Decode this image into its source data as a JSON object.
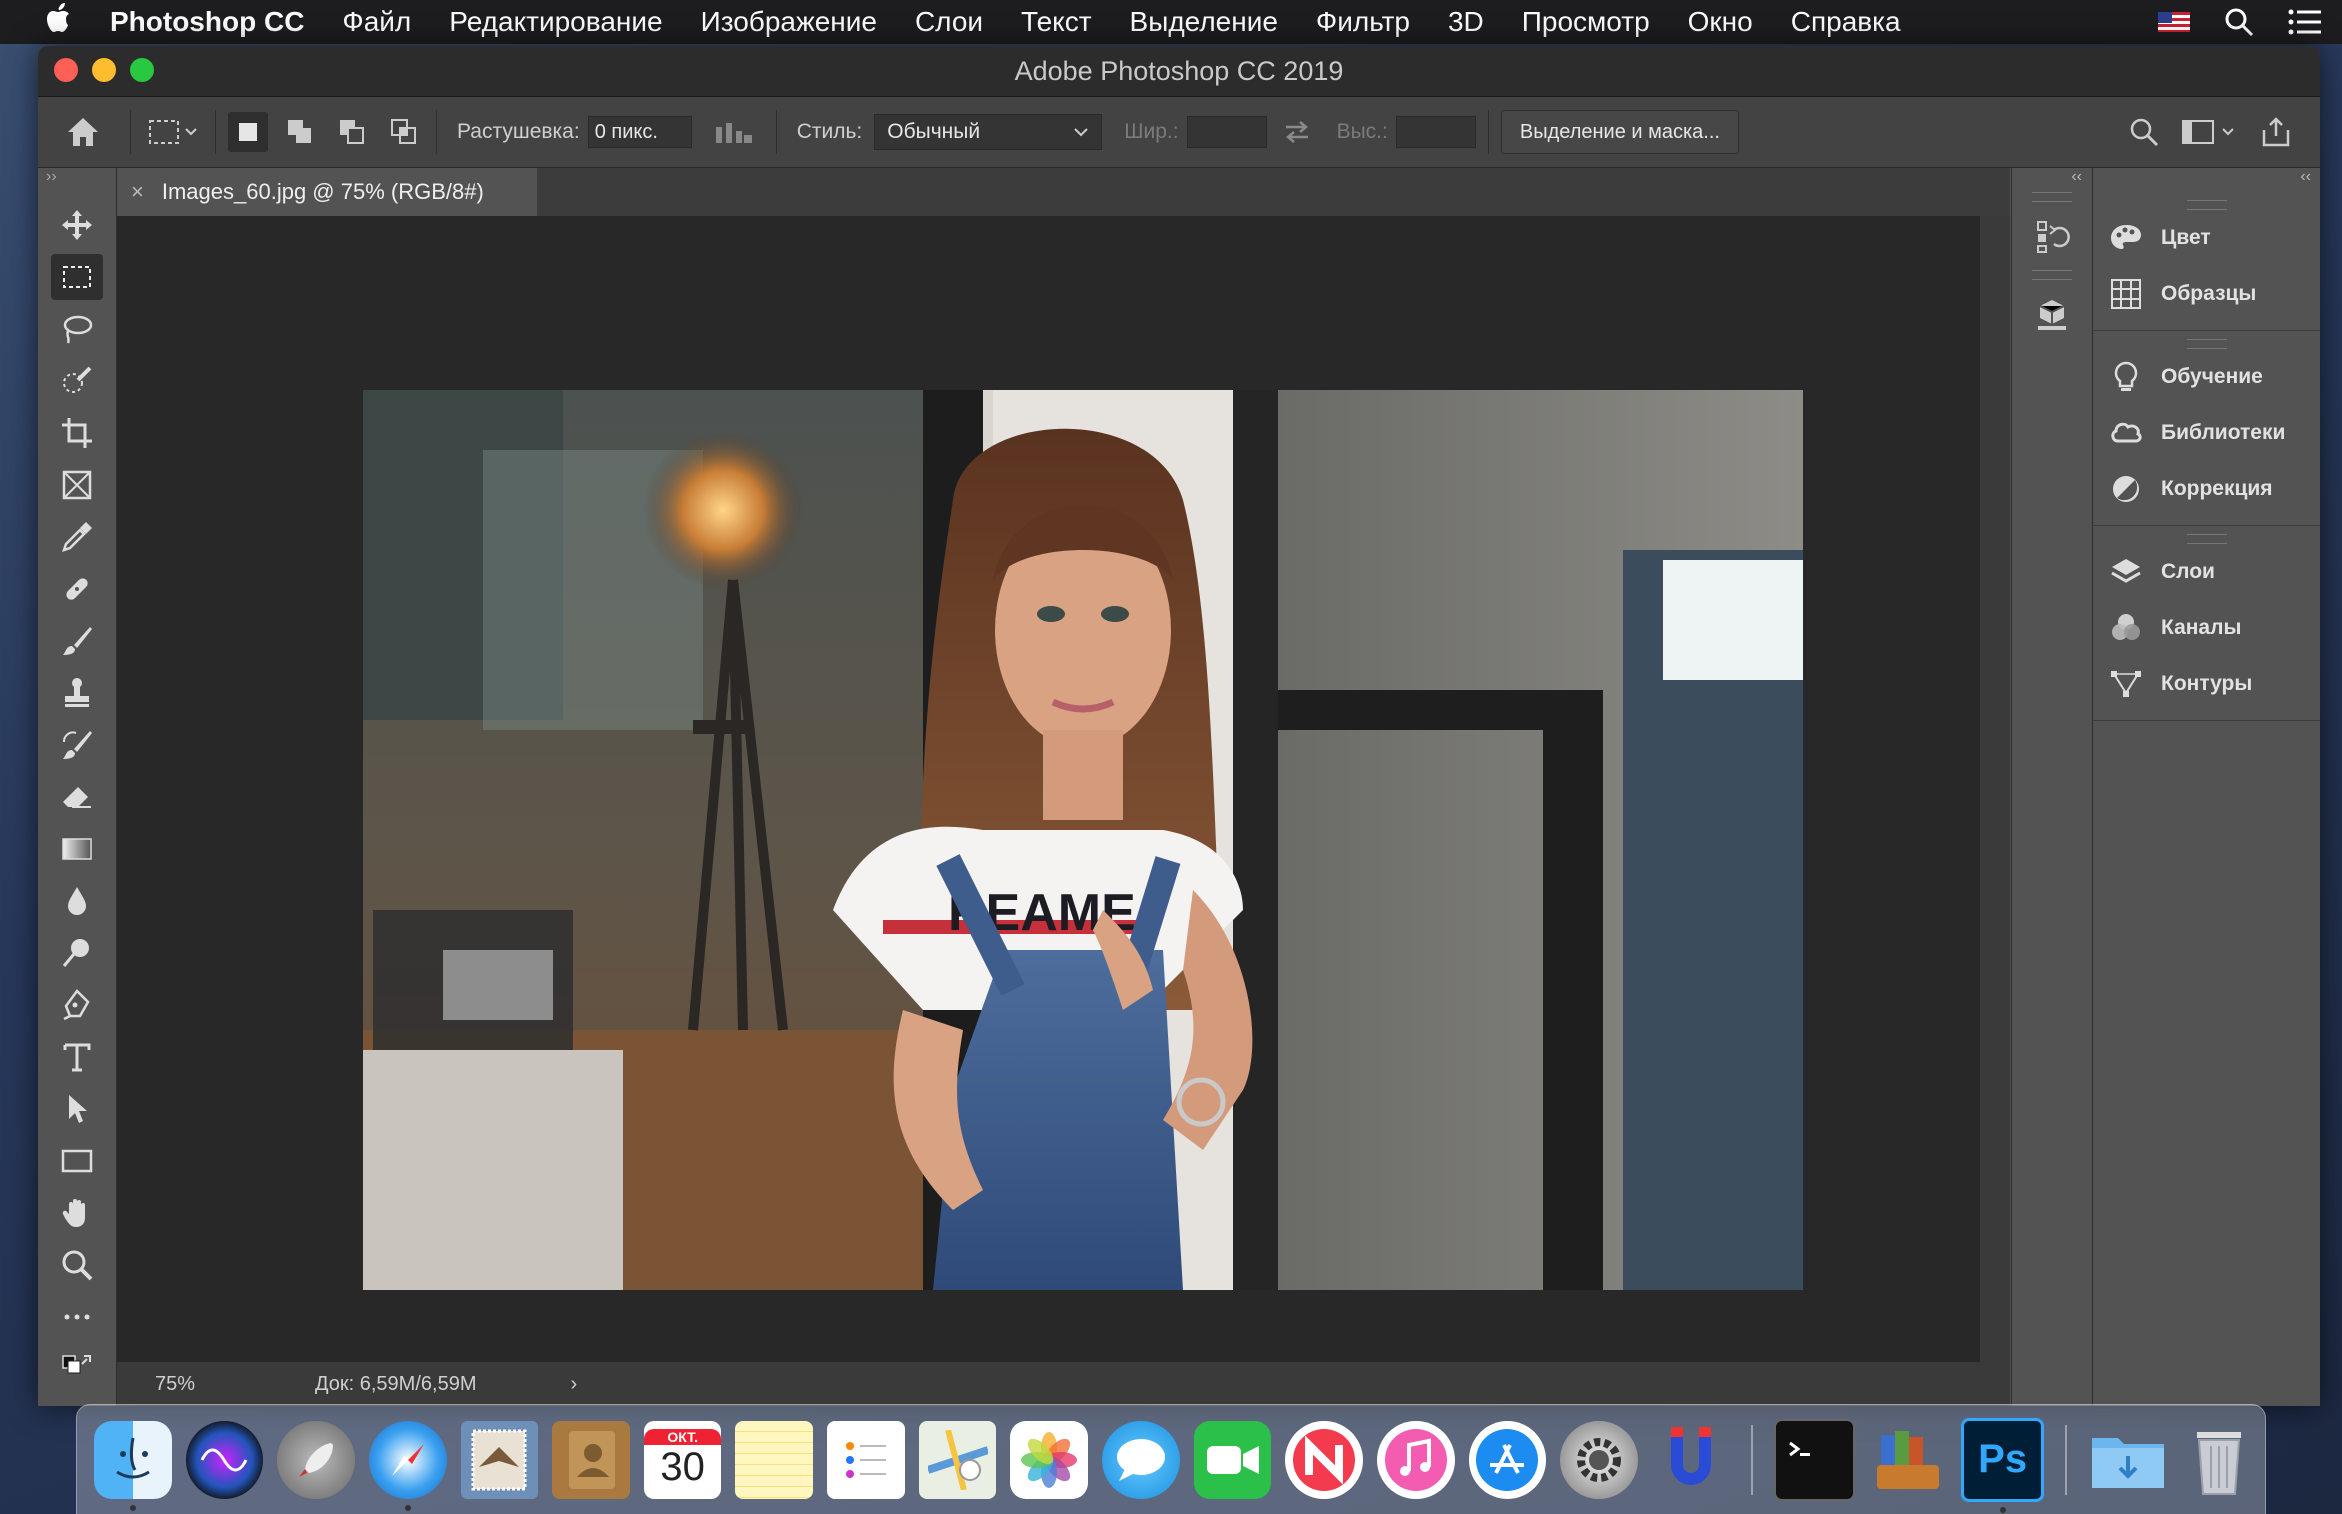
{
  "menubar": {
    "app": "Photoshop CC",
    "items": [
      "Файл",
      "Редактирование",
      "Изображение",
      "Слои",
      "Текст",
      "Выделение",
      "Фильтр",
      "3D",
      "Просмотр",
      "Окно",
      "Справка"
    ]
  },
  "window": {
    "title": "Adobe Photoshop CC 2019"
  },
  "options": {
    "feather_label": "Растушевка:",
    "feather_value": "0 пикс.",
    "style_label": "Стиль:",
    "style_value": "Обычный",
    "width_label": "Шир.:",
    "height_label": "Выс.:",
    "select_mask": "Выделение и маска..."
  },
  "document": {
    "tab_title": "Images_60.jpg @ 75% (RGB/8#)",
    "shirt_text": "REAME",
    "zoom": "75%",
    "doc_info": "Док: 6,59M/6,59M"
  },
  "panels": {
    "group1": [
      "Цвет",
      "Образцы"
    ],
    "group2": [
      "Обучение",
      "Библиотеки",
      "Коррекция"
    ],
    "group3": [
      "Слои",
      "Каналы",
      "Контуры"
    ]
  },
  "dock": {
    "calendar_month": "ОКТ.",
    "calendar_day": "30",
    "ps_label": "Ps"
  },
  "colors": {
    "accent": "#31a8ff",
    "workspace": "#282828",
    "panel": "#535353"
  }
}
